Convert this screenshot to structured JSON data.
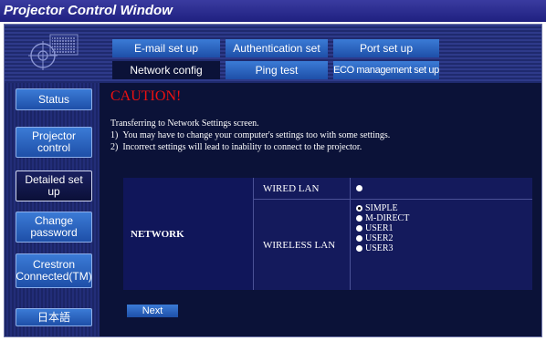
{
  "window": {
    "title": "Projector Control Window"
  },
  "sidebar": {
    "items": [
      {
        "label": "Status"
      },
      {
        "label": "Projector control"
      },
      {
        "label": "Detailed set up"
      },
      {
        "label": "Change password"
      },
      {
        "label": "Crestron Connected(TM)"
      },
      {
        "label": "日本語"
      }
    ]
  },
  "tabs": {
    "row1": [
      {
        "label": "E-mail set up"
      },
      {
        "label": "Authentication set up"
      },
      {
        "label": "Port set up"
      }
    ],
    "row2": [
      {
        "label": "Network config"
      },
      {
        "label": "Ping test"
      },
      {
        "label": "ECO management set up"
      }
    ]
  },
  "main": {
    "caution_title": "CAUTION!",
    "notes": [
      "Transferring to Network Settings screen.",
      "1)  You may have to change your computer's settings too with some settings.",
      "2)  Incorrect settings will lead to inability to connect to the projector."
    ],
    "network": {
      "label": "NETWORK",
      "wired_label": "WIRED LAN",
      "wireless_label": "WIRELESS LAN",
      "wireless_options": [
        "SIMPLE",
        "M-DIRECT",
        "USER1",
        "USER2",
        "USER3"
      ],
      "selected": "SIMPLE"
    },
    "next_label": "Next"
  },
  "colors": {
    "background": "#0b1238",
    "caution": "#ee1111",
    "button": "#2a66c4"
  }
}
